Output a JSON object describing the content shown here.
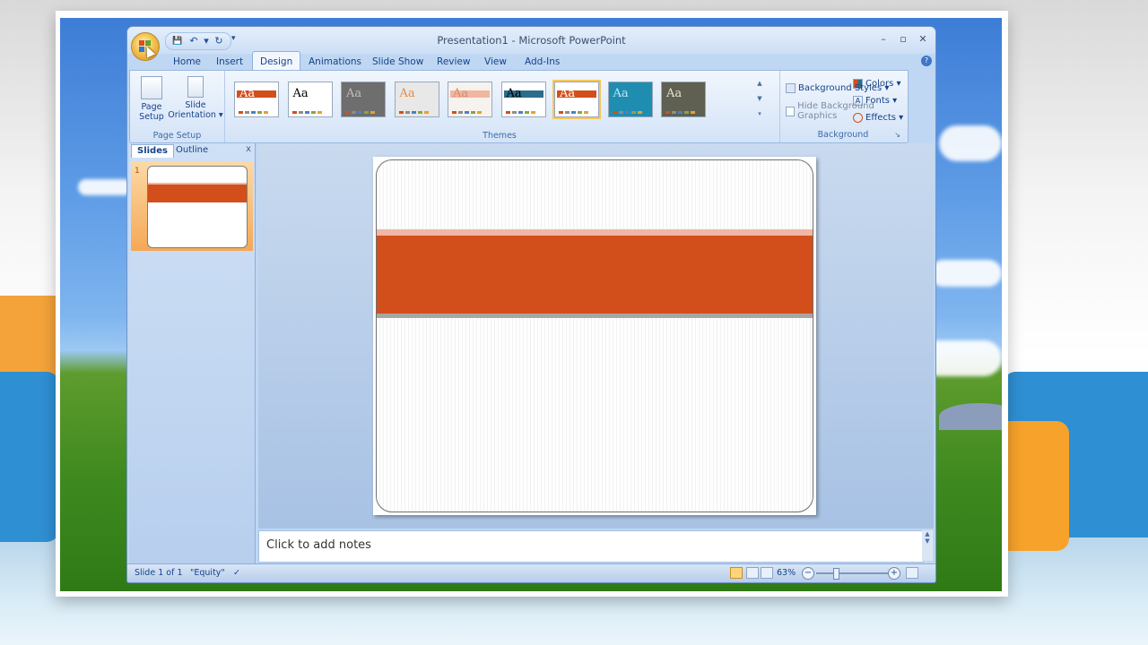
{
  "window": {
    "title": "Presentation1 - Microsoft PowerPoint",
    "controls": [
      "–",
      "▫",
      "✕"
    ]
  },
  "qat": {
    "save": "💾",
    "undo": "↶",
    "undo_drop": "▾",
    "redo": "↻",
    "customize": "▾"
  },
  "ribbon": {
    "tabs": [
      "Home",
      "Insert",
      "Design",
      "Animations",
      "Slide Show",
      "Review",
      "View",
      "Add-Ins"
    ],
    "active_tab": "Design",
    "page_setup": {
      "page_setup_label": "Page\nSetup",
      "page_setup_l1": "Page",
      "page_setup_l2": "Setup",
      "orientation_l1": "Slide",
      "orientation_l2": "Orientation ▾",
      "group_label": "Page Setup"
    },
    "themes": {
      "group_label": "Themes",
      "items": [
        {
          "name": "theme-office-orange",
          "aa": "Aa",
          "bg": "#ffffff",
          "bar": "#d24f1c",
          "text_color": "#ffffff"
        },
        {
          "name": "theme-office",
          "aa": "Aa",
          "bg": "#ffffff",
          "bar": "",
          "text_color": "#000000"
        },
        {
          "name": "theme-dark-grey",
          "aa": "Aa",
          "bg": "#6e6e6e",
          "bar": "",
          "text_color": "#bfbfbf"
        },
        {
          "name": "theme-orange-grey",
          "aa": "Aa",
          "bg": "#e8e8e8",
          "bar": "",
          "text_color": "#e7893e"
        },
        {
          "name": "theme-light-orange",
          "aa": "Aa",
          "bg": "#f6f3ee",
          "bar": "#f0b7a0",
          "text_color": "#d98b6b"
        },
        {
          "name": "theme-white-blue",
          "aa": "Aa",
          "bg": "#ffffff",
          "bar": "#2c6d8e",
          "text_color": "#000000"
        },
        {
          "name": "theme-equity",
          "aa": "Aa",
          "bg": "#ffffff",
          "bar": "#d24f1c",
          "text_color": "#ffffff"
        },
        {
          "name": "theme-teal",
          "aa": "Aa",
          "bg": "#1f8db0",
          "bar": "",
          "text_color": "#bde8f5"
        },
        {
          "name": "theme-olive",
          "aa": "Aa",
          "bg": "#5f5f52",
          "bar": "",
          "text_color": "#e8e4d0"
        }
      ]
    },
    "theme_options": {
      "colors": "Colors ▾",
      "fonts": "Fonts ▾",
      "effects": "Effects ▾"
    },
    "background": {
      "group_label": "Background",
      "styles": "Background Styles ▾",
      "hide_graphics": "Hide Background Graphics",
      "hide_graphics_checked": false
    }
  },
  "pane": {
    "tabs": [
      "Slides",
      "Outline"
    ],
    "close": "x",
    "slide_number": "1"
  },
  "notes": {
    "placeholder": "Click to add notes"
  },
  "status": {
    "slide": "Slide 1 of 1",
    "theme": "\"Equity\"",
    "zoom": "63%"
  }
}
